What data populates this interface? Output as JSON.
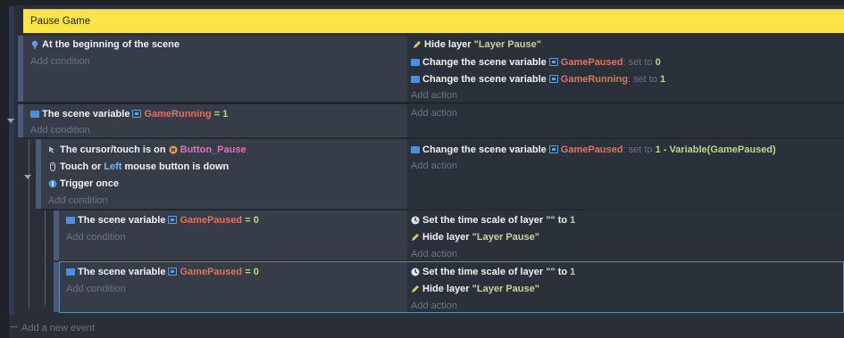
{
  "group": {
    "title": "Pause Game"
  },
  "events": [
    {
      "conditions": [
        {
          "icon": "info-icon",
          "text": "At the beginning of the scene"
        }
      ],
      "add_condition": "Add condition",
      "actions": [
        {
          "icon": "pencil-icon",
          "prefix": "Hide layer",
          "value": "\"Layer Pause\""
        },
        {
          "icon": "variable-icon",
          "prefix": "Change the scene variable",
          "var": "GamePaused",
          "mid": ": set to",
          "value": "0"
        },
        {
          "icon": "variable-icon",
          "prefix": "Change the scene variable",
          "var": "GameRunning",
          "mid": ": set to",
          "value": "1"
        }
      ],
      "add_action": "Add action"
    },
    {
      "conditions": [
        {
          "icon": "variable-icon",
          "prefix": "The scene variable",
          "var": "GameRunning",
          "op": "= 1"
        }
      ],
      "add_condition": "Add condition",
      "add_action": "Add action"
    },
    {
      "conditions": [
        {
          "icon": "cursor-icon",
          "prefix": "The cursor/touch is on",
          "object": "Button_Pause"
        },
        {
          "icon": "mouse-icon",
          "prefix": "Touch or",
          "key": "Left",
          "suffix": "mouse button is down"
        },
        {
          "icon": "trigger-icon",
          "text": "Trigger once"
        }
      ],
      "add_condition": "Add condition",
      "actions": [
        {
          "icon": "variable-icon",
          "prefix": "Change the scene variable",
          "var": "GamePaused",
          "mid": ": set to",
          "value": "1 - Variable(GamePaused)"
        }
      ],
      "add_action": "Add action"
    },
    {
      "conditions": [
        {
          "icon": "variable-icon",
          "prefix": "The scene variable",
          "var": "GamePaused",
          "op": "= 0"
        }
      ],
      "add_condition": "Add condition",
      "actions": [
        {
          "icon": "clock-icon",
          "prefix": "Set the time scale of layer",
          "value": "\"\"",
          "mid": "to",
          "value2": "1"
        },
        {
          "icon": "pencil-icon",
          "prefix": "Hide layer",
          "value": "\"Layer Pause\""
        }
      ],
      "add_action": "Add action"
    },
    {
      "conditions": [
        {
          "icon": "variable-icon",
          "prefix": "The scene variable",
          "var": "GamePaused",
          "op": "= 0"
        }
      ],
      "add_condition": "Add condition",
      "actions": [
        {
          "icon": "clock-icon",
          "prefix": "Set the time scale of layer",
          "value": "\"\"",
          "mid": "to",
          "value2": "1"
        },
        {
          "icon": "pencil-icon",
          "prefix": "Hide layer",
          "value": "\"Layer Pause\""
        }
      ],
      "add_action": "Add action"
    }
  ],
  "add_new_event": "Add a new event",
  "colors": {
    "group_bar": "#fbe44a",
    "variable": "#e0735a",
    "string": "#c9d19a",
    "number": "#b6d98a",
    "keyword": "#7fb6e8",
    "object": "#e070c0",
    "placeholder": "#6b7484"
  }
}
